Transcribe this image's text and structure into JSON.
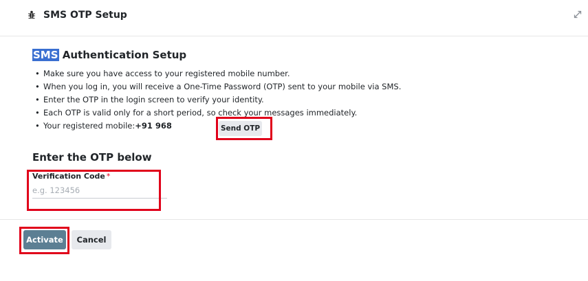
{
  "header": {
    "title": "SMS OTP Setup",
    "icon": "bug-icon",
    "expand_icon": "expand-icon"
  },
  "section": {
    "title_highlight": "SMS",
    "title_rest": " Authentication Setup",
    "highlight_color": "#3a6fd1",
    "instructions": [
      "Make sure you have access to your registered mobile number.",
      "When you log in, you will receive a One-Time Password (OTP) sent to your mobile via SMS.",
      "Enter the OTP in the login screen to verify your identity.",
      "Each OTP is valid only for a short period, so check your messages immediately."
    ],
    "mobile_label": "Your registered mobile:",
    "mobile_value": "+91 968",
    "send_otp_label": "Send OTP"
  },
  "otp": {
    "heading": "Enter the OTP below",
    "field_label": "Verification Code",
    "required_mark": "*",
    "placeholder": "e.g. 123456",
    "value": ""
  },
  "footer": {
    "activate_label": "Activate",
    "cancel_label": "Cancel",
    "activate_color": "#5c7f93"
  },
  "annotation_color": "#e0001a"
}
